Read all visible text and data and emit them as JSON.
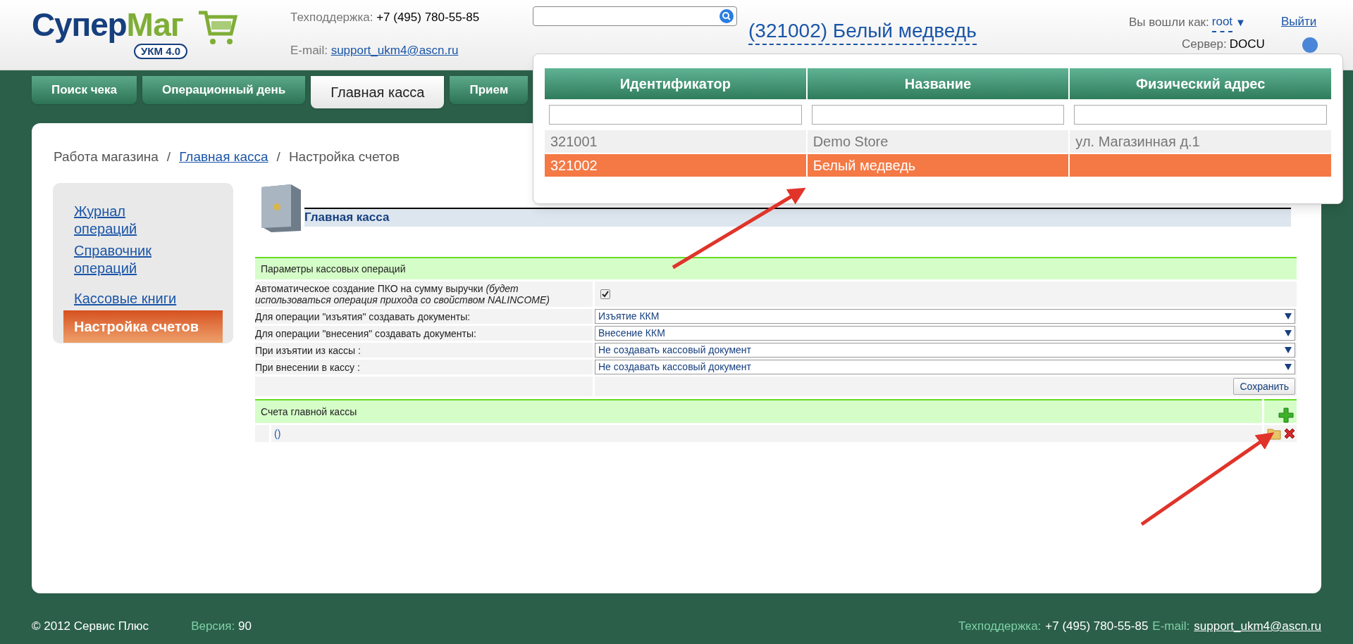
{
  "header": {
    "logo": {
      "text_dark": "Супер",
      "text_green": "Маг",
      "badge": "УКМ 4.0"
    },
    "support": {
      "label": "Техподдержка:",
      "phone": "+7 (495) 780-55-85",
      "email_label": "E-mail:",
      "email": "support_ukm4@ascn.ru"
    },
    "store": "(321002) Белый медведь",
    "user": {
      "label": "Вы вошли как:",
      "name": "root",
      "caret": "▼",
      "logout": "Выйти",
      "server_label": "Сервер:",
      "server": "DOCU"
    }
  },
  "tabs": [
    {
      "label": "Поиск чека",
      "selected": false
    },
    {
      "label": "Операционный день",
      "selected": false
    },
    {
      "label": "Главная касса",
      "selected": true
    },
    {
      "label": "Прием",
      "selected": false
    }
  ],
  "breadcrumb": {
    "separator": "/",
    "items": [
      {
        "label": "Работа магазина",
        "link": false
      },
      {
        "label": "Главная касса",
        "link": true
      },
      {
        "label": "Настройка счетов",
        "link": false
      }
    ]
  },
  "sidebar": {
    "items": [
      {
        "label": "Журнал операций",
        "selected": false
      },
      {
        "label": "Справочник операций",
        "selected": false
      },
      {
        "label": "Кассовые книги",
        "selected": false
      },
      {
        "label": "Настройка счетов",
        "selected": true
      }
    ]
  },
  "module": {
    "title": "Главная касса"
  },
  "params": {
    "title": "Параметры кассовых операций",
    "rows": [
      {
        "kind": "checkbox",
        "label": "Автоматическое создание ПКО на сумму выручки *(будет использоваться операция прихода со свойством NALINCOME)*",
        "checked": true
      },
      {
        "kind": "select",
        "label": "Для операции \"изъятия\" создавать документы:",
        "value": "Изъятие ККМ"
      },
      {
        "kind": "select",
        "label": "Для операции \"внесения\" создавать документы:",
        "value": "Внесение ККМ"
      },
      {
        "kind": "select",
        "label": "При изъятии из кассы :",
        "value": "Не создавать кассовый документ"
      },
      {
        "kind": "select",
        "label": "При внесении в кассу :",
        "value": "Не создавать кассовый документ"
      }
    ],
    "save": "Сохранить"
  },
  "accounts": {
    "title": "Счета главной кассы",
    "rows": [
      {
        "label": "()"
      }
    ]
  },
  "store_popup": {
    "columns": [
      "Идентификатор",
      "Название",
      "Физический адрес"
    ],
    "rows": [
      {
        "id": "321001",
        "name": "Demo Store",
        "address": "ул. Магазинная д.1",
        "selected": false
      },
      {
        "id": "321002",
        "name": "Белый медведь",
        "address": "",
        "selected": true
      }
    ]
  },
  "footer": {
    "copyright": "© 2012 Сервис Плюс",
    "version_label": "Версия:",
    "version": "90",
    "support_label": "Техподдержка:",
    "phone": "+7 (495) 780-55-85",
    "email_label": "E-mail:",
    "email": "support_ukm4@ascn.ru"
  }
}
